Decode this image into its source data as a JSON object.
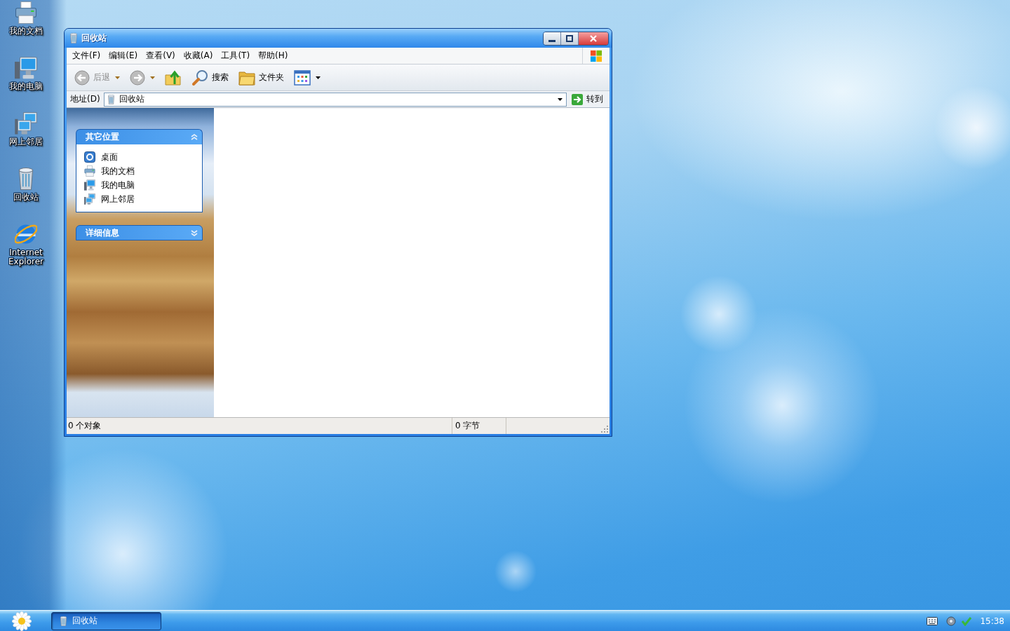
{
  "desktop": {
    "icons": [
      {
        "kind": "documents",
        "label": "我的文档"
      },
      {
        "kind": "computer",
        "label": "我的电脑"
      },
      {
        "kind": "network",
        "label": "网上邻居"
      },
      {
        "kind": "recycle",
        "label": "回收站"
      },
      {
        "kind": "browser",
        "label": "Internet Explorer"
      }
    ]
  },
  "window": {
    "title": "回收站",
    "menu": [
      "文件(F)",
      "编辑(E)",
      "查看(V)",
      "收藏(A)",
      "工具(T)",
      "帮助(H)"
    ],
    "toolbar": [
      {
        "kind": "back",
        "label": "后退",
        "disabled": true,
        "dropdown": true
      },
      {
        "kind": "forward",
        "disabled": true,
        "dropdown": true
      },
      {
        "kind": "up",
        "disabled": false,
        "dropdown": false
      },
      {
        "kind": "search",
        "label": "搜索",
        "disabled": false,
        "dropdown": false
      },
      {
        "kind": "folders",
        "label": "文件夹",
        "disabled": false,
        "dropdown": false
      },
      {
        "kind": "views",
        "disabled": false,
        "dropdown": true
      }
    ],
    "address": {
      "label": "地址(D)",
      "value": "回收站",
      "go": "转到"
    },
    "task_panes": [
      {
        "title": "其它位置",
        "expanded": true,
        "items": [
          {
            "kind": "desktop",
            "label": "桌面"
          },
          {
            "kind": "documents",
            "label": "我的文档"
          },
          {
            "kind": "computer",
            "label": "我的电脑"
          },
          {
            "kind": "network",
            "label": "网上邻居"
          }
        ]
      },
      {
        "title": "详细信息",
        "expanded": false
      }
    ],
    "status_bar": [
      "0 个对象",
      "0 字节"
    ]
  },
  "taskbar": {
    "tasks": [
      {
        "label": "回收站",
        "selected": true
      }
    ],
    "clock": "15:38"
  }
}
